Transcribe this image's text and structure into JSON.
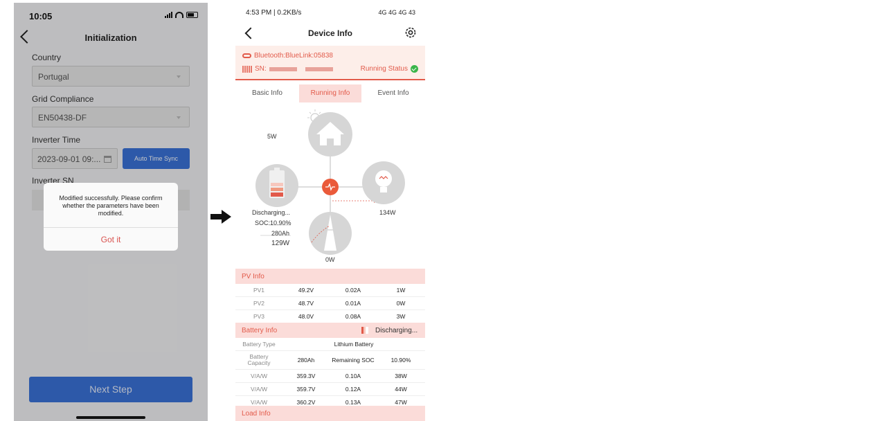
{
  "left": {
    "status": {
      "time": "10:05"
    },
    "title": "Initialization",
    "country": {
      "label": "Country",
      "value": "Portugal"
    },
    "grid": {
      "label": "Grid Compliance",
      "value": "EN50438-DF"
    },
    "inverter_time": {
      "label": "Inverter Time",
      "value": "2023-09-01 09:...",
      "sync_button": "Auto Time Sync"
    },
    "inverter_sn": {
      "label": "Inverter SN"
    },
    "dialog": {
      "message": "Modified successfully. Please confirm whether the parameters have been modified.",
      "button": "Got it"
    },
    "next_button": "Next Step"
  },
  "right": {
    "status": {
      "left": "4:53 PM | 0.2KB/s",
      "right": "4G 4G 4G 43"
    },
    "title": "Device Info",
    "connection": {
      "bluetooth": "Bluetooth:BlueLink:05838",
      "sn_label": "SN:",
      "running_status": "Running Status"
    },
    "tabs": [
      "Basic Info",
      "Running Info",
      "Event Info"
    ],
    "flow": {
      "pv_power": "5W",
      "load_power": "134W",
      "battery_state": "Discharging...",
      "battery_soc": "SOC:10.90%",
      "battery_capacity": "280Ah",
      "battery_power": "129W",
      "grid_power": "0W"
    },
    "pv_info": {
      "title": "PV Info",
      "rows": [
        [
          "PV1",
          "49.2V",
          "0.02A",
          "1W"
        ],
        [
          "PV2",
          "48.7V",
          "0.01A",
          "0W"
        ],
        [
          "PV3",
          "48.0V",
          "0.08A",
          "3W"
        ]
      ]
    },
    "battery_info": {
      "title": "Battery Info",
      "state": "Discharging...",
      "type_label": "Battery Type",
      "type_value": "Lithium Battery",
      "capacity_label": "Battery Capacity",
      "capacity_value": "280Ah",
      "soc_label": "Remaining SOC",
      "soc_value": "10.90%",
      "rows": [
        [
          "V/A/W",
          "359.3V",
          "0.10A",
          "38W"
        ],
        [
          "V/A/W",
          "359.7V",
          "0.12A",
          "44W"
        ],
        [
          "V/A/W",
          "360.2V",
          "0.13A",
          "47W"
        ]
      ]
    },
    "load_info": {
      "title": "Load Info"
    }
  }
}
